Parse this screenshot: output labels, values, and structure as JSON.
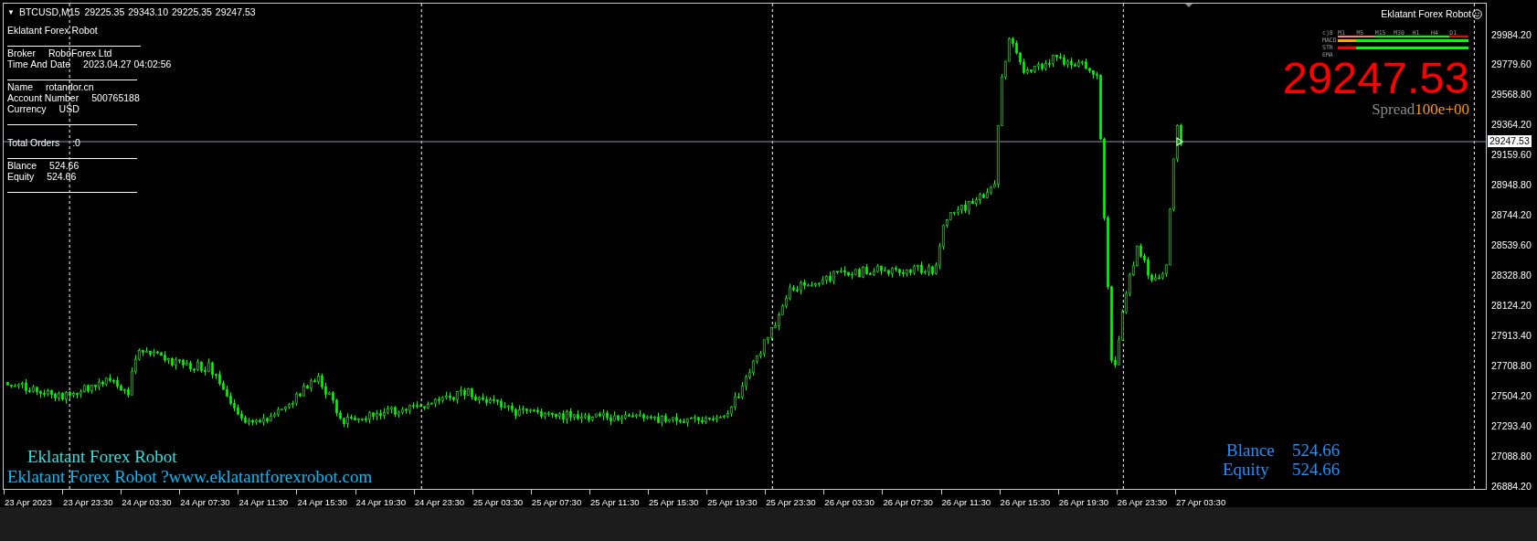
{
  "chart_header": {
    "menu_glyph": "▼",
    "symbol": "BTCUSD,M15",
    "prices": [
      "29225.35",
      "29343.10",
      "29225.35",
      "29247.53"
    ]
  },
  "info_panel": {
    "title": "Eklatant Forex Robot",
    "groups": [
      {
        "rows": [
          {
            "label": "Broker",
            "value": "RoboForex Ltd"
          },
          {
            "label": "Time And Date",
            "value": "2023.04.27 04:02:56"
          }
        ]
      },
      {
        "rows": [
          {
            "label": "Name",
            "value": "rotandor.cn"
          },
          {
            "label": "Account Number",
            "value": "500765188"
          },
          {
            "label": "Currency",
            "value": "USD"
          }
        ]
      },
      {
        "rows": [
          {
            "label": "Total Orders",
            "value": ":0"
          }
        ]
      },
      {
        "rows": [
          {
            "label": "Blance",
            "value": "524.66"
          },
          {
            "label": "Equity",
            "value": "524.66"
          }
        ]
      }
    ]
  },
  "expert": {
    "name": "Eklatant Forex Robot"
  },
  "signal_matrix": {
    "corner": "cj8",
    "timeframes": [
      {
        "label": "M1",
        "color": "#fa8072"
      },
      {
        "label": "M5",
        "color": "#fa8072"
      },
      {
        "label": "M15",
        "color": "#00ff00"
      },
      {
        "label": "M30",
        "color": "#00ff00"
      },
      {
        "label": "H1",
        "color": "#00ff00"
      },
      {
        "label": "H4",
        "color": "#00ff00"
      },
      {
        "label": "D1",
        "color": "#ff0000"
      }
    ],
    "rows": [
      {
        "label": "MACD",
        "signals": [
          {
            "color": "#ffa500"
          },
          {
            "color": "#00ff00"
          },
          {
            "color": "#00ff00"
          },
          {
            "color": "#00ff00"
          },
          {
            "color": "#00ff00"
          },
          {
            "color": "#00ff00"
          },
          {
            "color": "#00ff00"
          }
        ]
      },
      {
        "label": "STR",
        "signals": [
          {
            "color": "#ff0000"
          },
          {
            "color": "#00ff00"
          },
          {
            "color": "#00ff00"
          },
          {
            "color": "#00ff00"
          },
          {
            "color": "#00ff00"
          },
          {
            "color": "#00ff00"
          },
          {
            "color": "#00ff00"
          }
        ]
      },
      {
        "label": "EMA"
      }
    ]
  },
  "price_display": {
    "price": "29247.53",
    "spread_label": "Spread",
    "spread_value": "100e+00"
  },
  "footer_texts": [
    {
      "text": "Eklatant Forex Robot",
      "color": "#30e0e0"
    },
    {
      "text": "Eklatant Forex Robot ?www.eklatantforexrobot.com",
      "color": "#00bfff"
    }
  ],
  "account_summary": [
    {
      "label": "Blance",
      "value": "524.66"
    },
    {
      "label": "Equity",
      "value": "524.66"
    }
  ],
  "price_axis": {
    "labels": [
      "29984.20",
      "29779.60",
      "29568.80",
      "29364.20",
      "29159.60",
      "28948.80",
      "28744.20",
      "28539.60",
      "28328.80",
      "28124.20",
      "27913.40",
      "27708.80",
      "27504.20",
      "27293.40",
      "27088.80",
      "26884.20"
    ],
    "current": "29247.53"
  },
  "time_axis": {
    "labels": [
      "23 Apr 2023",
      "23 Apr 23:30",
      "24 Apr 03:30",
      "24 Apr 07:30",
      "24 Apr 11:30",
      "24 Apr 15:30",
      "24 Apr 19:30",
      "24 Apr 23:30",
      "25 Apr 03:30",
      "25 Apr 07:30",
      "25 Apr 11:30",
      "25 Apr 15:30",
      "25 Apr 19:30",
      "25 Apr 23:30",
      "26 Apr 03:30",
      "26 Apr 07:30",
      "26 Apr 11:30",
      "26 Apr 15:30",
      "26 Apr 19:30",
      "26 Apr 23:30",
      "27 Apr 03:30"
    ]
  }
}
